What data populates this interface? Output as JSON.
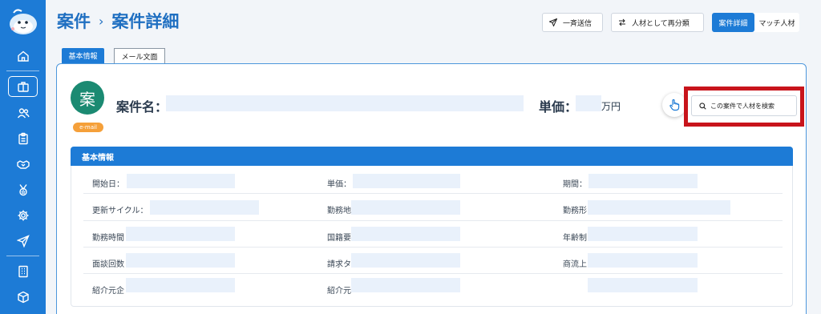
{
  "breadcrumb": {
    "parent": "案件",
    "separator": "›",
    "current": "案件詳細"
  },
  "header": {
    "send_all": "一斉送信",
    "reclassify": "人材として再分類",
    "view_detail": "案件詳細",
    "view_match": "マッチ人材"
  },
  "tabs": {
    "basic": "基本情報",
    "mail": "メール文面"
  },
  "job": {
    "avatar_char": "案",
    "source_badge": "e-mail",
    "name_label": "案件名：",
    "price_label": "単価：",
    "price_unit": "万円",
    "search_button": "この案件で人材を検索"
  },
  "info": {
    "title": "基本情報",
    "fields": {
      "start_date": "開始日：",
      "unit_price": "単価：",
      "period": "期間：",
      "renewal_cycle": "更新サイクル：",
      "work_location": "勤務地",
      "work_form": "勤務形",
      "work_hours": "勤務時間",
      "nationality": "国籍要",
      "age_limit": "年齢制",
      "interview_count": "面談回数",
      "billing": "請求タ",
      "commercial_flow": "商流上",
      "referrer_company": "紹介元企",
      "referrer": "紹介元"
    }
  },
  "colors": {
    "primary": "#1d7bd6",
    "highlight": "#c8141b",
    "avatar": "#1b8a72",
    "badge": "#f5a03a"
  }
}
